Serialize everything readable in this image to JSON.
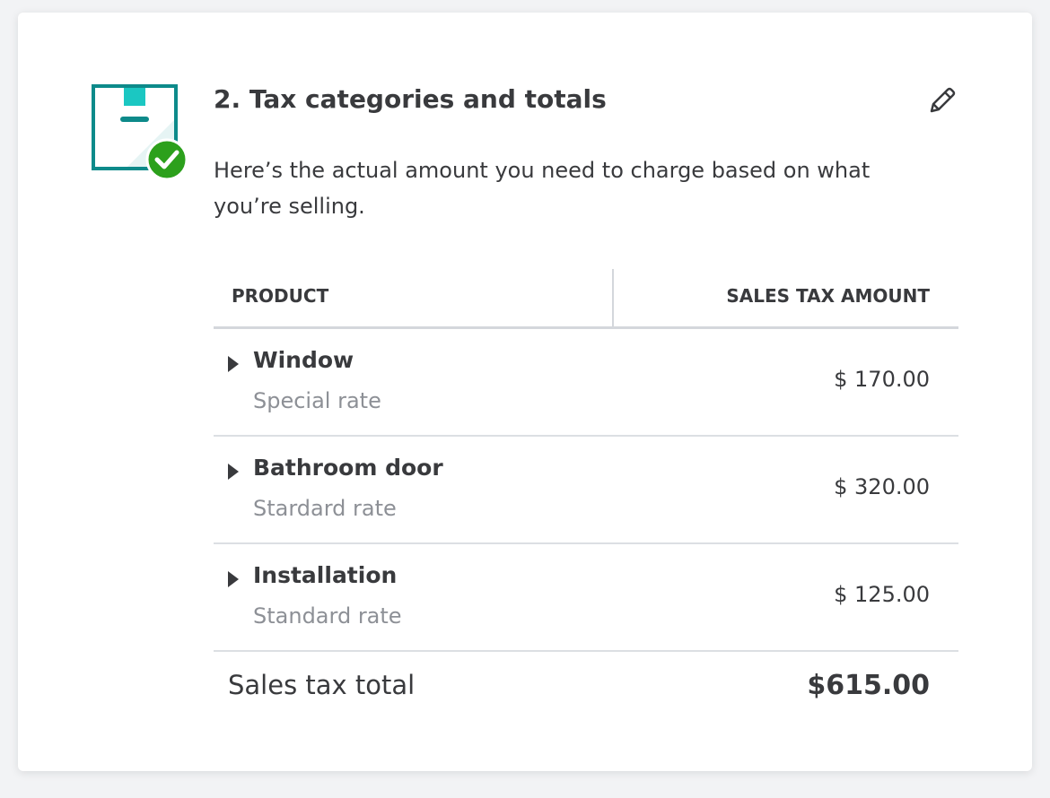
{
  "section": {
    "title": "2. Tax categories and totals",
    "description": "Here’s the actual amount you need to charge based on what you’re selling.",
    "status": "complete"
  },
  "colors": {
    "accent_teal": "#0d8a8a",
    "accent_light_teal": "#1bc7c2",
    "success_green": "#2ca01c"
  },
  "icons": {
    "step": "document-with-check-icon",
    "edit": "pencil-icon",
    "expand": "caret-right-icon"
  },
  "table": {
    "headers": {
      "product": "PRODUCT",
      "amount": "SALES TAX AMOUNT"
    },
    "rows": [
      {
        "name": "Window",
        "rate": "Special rate",
        "amount": "$ 170.00"
      },
      {
        "name": "Bathroom door",
        "rate": "Stardard rate",
        "amount": "$ 320.00"
      },
      {
        "name": "Installation",
        "rate": "Standard rate",
        "amount": "$ 125.00"
      }
    ],
    "total": {
      "label": "Sales tax total",
      "value": "$615.00"
    }
  }
}
